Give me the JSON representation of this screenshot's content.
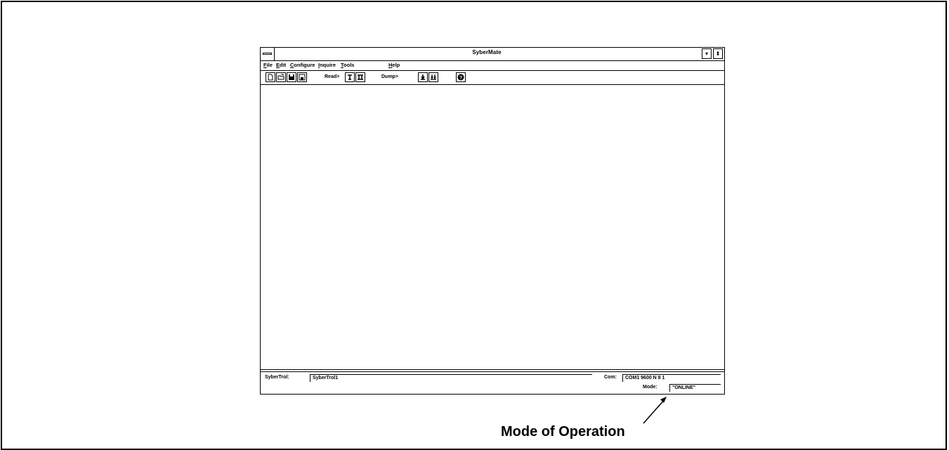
{
  "window": {
    "title": "SyberMate",
    "min_button": "▾",
    "max_button": "⬍"
  },
  "menu": {
    "items": [
      "File",
      "Edit",
      "Configure",
      "Inquire",
      "Tools",
      "Help"
    ]
  },
  "toolbar": {
    "read_label": "Read>",
    "dump_label": "Dump>",
    "icons": [
      "new-file-icon",
      "open-folder-icon",
      "save-icon",
      "save-as-icon",
      "read-single-icon",
      "read-all-icon",
      "dump-single-icon",
      "dump-all-icon",
      "help-icon"
    ]
  },
  "status": {
    "sybertrol_label": "SyberTrol:",
    "sybertrol_value": "SyberTrol1",
    "com_label": "Com:",
    "com_value": "COM1 9600 N 8 1",
    "mode_label": "Mode:",
    "mode_value": "\"ONLINE\""
  },
  "callout": {
    "text": "Mode of Operation"
  }
}
